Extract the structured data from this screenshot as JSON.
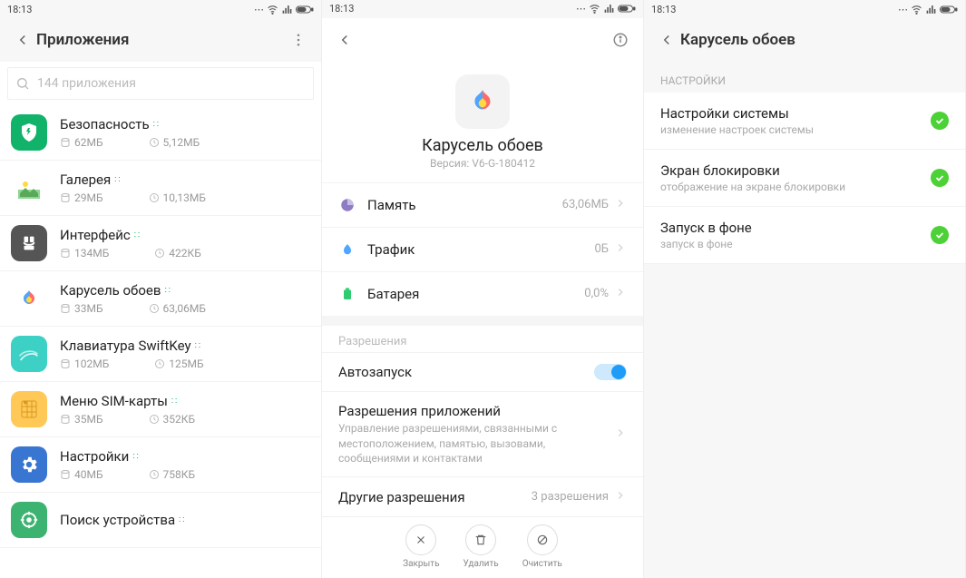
{
  "status": {
    "time": "18:13",
    "icons": "⋯"
  },
  "pane1": {
    "title": "Приложения",
    "search_placeholder": "144 приложения",
    "apps": [
      {
        "name": "Безопасность",
        "storage": "62МБ",
        "data": "5,12МБ"
      },
      {
        "name": "Галерея",
        "storage": "29МБ",
        "data": "10,13МБ"
      },
      {
        "name": "Интерфейс",
        "storage": "134МБ",
        "data": "422КБ"
      },
      {
        "name": "Карусель обоев",
        "storage": "33МБ",
        "data": "63,06МБ"
      },
      {
        "name": "Клавиатура SwiftKey",
        "storage": "102МБ",
        "data": "125МБ"
      },
      {
        "name": "Меню SIM-карты",
        "storage": "35МБ",
        "data": "352КБ"
      },
      {
        "name": "Настройки",
        "storage": "40МБ",
        "data": "758КБ"
      },
      {
        "name": "Поиск устройства",
        "storage": "",
        "data": ""
      }
    ]
  },
  "pane2": {
    "app_name": "Карусель обоев",
    "version": "Версия: V6-G-180412",
    "stats": {
      "memory_label": "Память",
      "memory_value": "63,06МБ",
      "traffic_label": "Трафик",
      "traffic_value": "0Б",
      "battery_label": "Батарея",
      "battery_value": "0,0%"
    },
    "perms_header": "Разрешения",
    "autostart": "Автозапуск",
    "app_perms_label": "Разрешения приложений",
    "app_perms_sub": "Управление разрешениями, связанными с местоположением, памятью, вызовами, сообщениями и контактами",
    "other_perms_label": "Другие разрешения",
    "other_perms_value": "3 разрешения",
    "actions": {
      "close": "Закрыть",
      "delete": "Удалить",
      "clear": "Очистить"
    }
  },
  "pane3": {
    "title": "Карусель обоев",
    "section": "НАСТРОЙКИ",
    "items": [
      {
        "title": "Настройки системы",
        "sub": "изменение настроек системы"
      },
      {
        "title": "Экран блокировки",
        "sub": "отображение на экране блокировки"
      },
      {
        "title": "Запуск в фоне",
        "sub": "запуск в фоне"
      }
    ]
  }
}
